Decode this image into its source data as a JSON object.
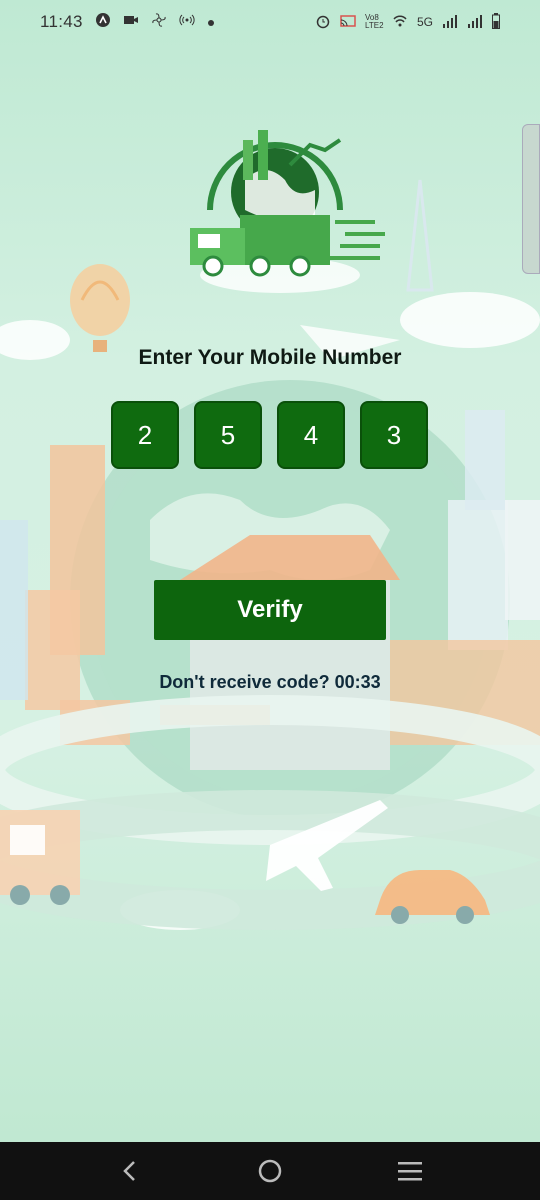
{
  "status_bar": {
    "time": "11:43",
    "network": "5G",
    "volte": "Vo8 LTE2",
    "icons": [
      "assistant-icon",
      "video-icon",
      "fan-icon",
      "hotspot-icon",
      "dot-icon",
      "alarm-icon",
      "cast-icon",
      "wifi-icon",
      "signal-icon",
      "signal-icon",
      "battery-icon"
    ]
  },
  "main": {
    "title": "Enter Your Mobile Number",
    "otp_digits": [
      "2",
      "5",
      "4",
      "3"
    ],
    "verify_label": "Verify",
    "resend_text": "Don't receive code? 00:33"
  },
  "nav": {
    "icons": [
      "back-icon",
      "home-icon",
      "menu-icon"
    ]
  },
  "colors": {
    "primary": "#0d650d",
    "background": "#d3f0e1"
  }
}
